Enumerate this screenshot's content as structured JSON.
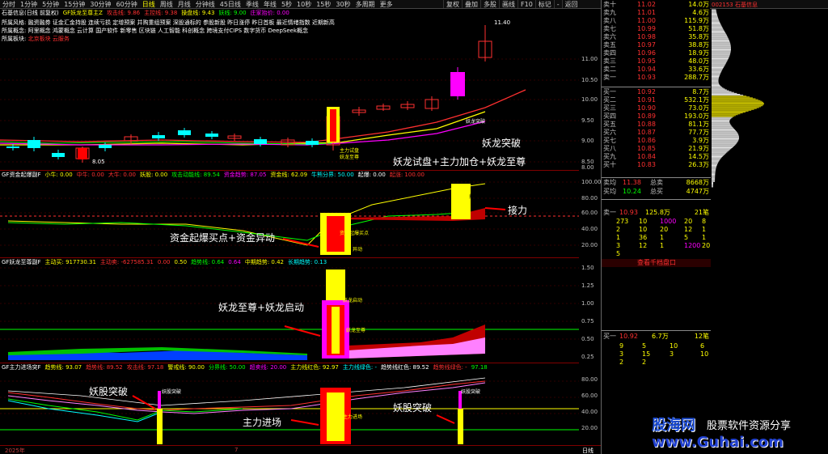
{
  "topbar": {
    "items": [
      "分时",
      "1分钟",
      "5分钟",
      "15分钟",
      "30分钟",
      "60分钟",
      "日线",
      "周线",
      "月线",
      "分钟线",
      "45日线",
      "季线",
      "年线",
      "5秒",
      "10秒",
      "15秒",
      "30秒",
      "多周期",
      "更多"
    ],
    "active_index": 6,
    "right_items": [
      "复权",
      "叠加",
      "多股",
      "画线",
      "F10",
      "标记",
      "-",
      "返回"
    ]
  },
  "stock_code": "002153",
  "stock_name": "石基信息",
  "main": {
    "title_parts": [
      "石基信息(日线 前复权)",
      "GF妖龙至尊主Z",
      "攻击线: 9.86",
      "主控线: 9.38",
      "操盘线: 9.43",
      "妖线: 9.00",
      "庄家抬价: 0.00"
    ],
    "info_lines": [
      [
        "所属风格:",
        "融资融券 证金汇金持股 连续亏损 定增预案 并购重组预案 深股通标的 参股新股 昨日涨停 昨日首板 最近情绪指数 近期新高"
      ],
      [
        "所属概念:",
        "阿里概念 鸿蒙概念 云计算 国产软件 新零售 区块链 人工智能 科创概念 跨境支付CIPS 数字货币 DeepSeek概念"
      ],
      [
        "所属板块:",
        "北京板块",
        "云服务"
      ]
    ],
    "price_high": "11.40",
    "price_low": "8.05",
    "annotations": [
      "妖龙突破",
      "妖龙试盘+主力加仓+妖龙至尊"
    ],
    "small_labels": [
      "妖龙突破",
      "主力试盘",
      "妖龙至尊"
    ],
    "axis_labels": [
      "11.00",
      "10.50",
      "10.00",
      "9.50",
      "9.00",
      "8.50",
      "8.00"
    ]
  },
  "panel2": {
    "title_parts": [
      "GF资金起爆副F",
      "小牛: 0.00",
      "中牛: 0.00",
      "大牛: 0.00",
      "妖股: 0.00",
      "攻击动能线: 89.54",
      "资金趋势: 87.05",
      "资金线: 62.09",
      "牛熊分界: 50.00",
      "起爆: 0.00",
      "起涨: 100.00"
    ],
    "annotations": [
      "资金起爆买点+资金异动",
      "接力"
    ],
    "small_labels": [
      "接力",
      "资金起爆买点",
      "异动"
    ],
    "axis_labels": [
      "100.00",
      "80.00",
      "60.00",
      "40.00",
      "20.00"
    ]
  },
  "panel3": {
    "title_parts": [
      "GF妖龙至尊副F",
      "主动买: 917730.31",
      "主动卖: -627585.31",
      "0.00",
      "0.50",
      "趋势线: 0.64",
      "0.64",
      "中期趋势: 0.42",
      "长期趋势: 0.13"
    ],
    "annotations": [
      "妖龙至尊+妖龙启动"
    ],
    "small_labels": [
      "妖龙启动",
      "妖龙至尊"
    ],
    "axis_labels": [
      "1.50",
      "1.25",
      "1.00",
      "0.75",
      "0.50",
      "0.25"
    ]
  },
  "panel4": {
    "title_parts": [
      "GF主力进场突F",
      "趋势线: 93.07",
      "趋势线: 89.52",
      "攻击线: 97.18",
      "警戒线: 90.00",
      "分界线: 50.00",
      "超卖线: 20.00",
      "主力线红色: 92.97",
      "主力线绿色: -",
      "趋势线红色: 89.52",
      "趋势线绿色: -",
      "97.18"
    ],
    "annotations": [
      "妖股突破",
      "主力进场",
      "妖股突破"
    ],
    "small_labels": [
      "妖股突破",
      "主力进场",
      "妖股突破"
    ],
    "axis_labels": [
      "80.00",
      "60.00",
      "40.00",
      "20.00"
    ]
  },
  "bottom": {
    "year": "2025年",
    "month": "7",
    "period": "日线"
  },
  "orderbook": {
    "asks": [
      {
        "label": "卖十",
        "price": "11.02",
        "vol": "14.0万"
      },
      {
        "label": "卖九",
        "price": "11.01",
        "vol": "4.6万"
      },
      {
        "label": "卖八",
        "price": "11.00",
        "vol": "115.9万"
      },
      {
        "label": "卖七",
        "price": "10.99",
        "vol": "51.8万"
      },
      {
        "label": "卖六",
        "price": "10.98",
        "vol": "35.8万"
      },
      {
        "label": "卖五",
        "price": "10.97",
        "vol": "38.8万"
      },
      {
        "label": "卖四",
        "price": "10.96",
        "vol": "18.9万"
      },
      {
        "label": "卖三",
        "price": "10.95",
        "vol": "48.0万"
      },
      {
        "label": "卖二",
        "price": "10.94",
        "vol": "33.6万"
      },
      {
        "label": "卖一",
        "price": "10.93",
        "vol": "288.7万"
      }
    ],
    "bids": [
      {
        "label": "买一",
        "price": "10.92",
        "vol": "8.7万"
      },
      {
        "label": "买二",
        "price": "10.91",
        "vol": "532.1万"
      },
      {
        "label": "买三",
        "price": "10.90",
        "vol": "73.0万"
      },
      {
        "label": "买四",
        "price": "10.89",
        "vol": "193.0万"
      },
      {
        "label": "买五",
        "price": "10.88",
        "vol": "81.1万"
      },
      {
        "label": "买六",
        "price": "10.87",
        "vol": "77.7万"
      },
      {
        "label": "买七",
        "price": "10.86",
        "vol": "3.9万"
      },
      {
        "label": "买八",
        "price": "10.85",
        "vol": "21.9万"
      },
      {
        "label": "买九",
        "price": "10.84",
        "vol": "14.5万"
      },
      {
        "label": "买十",
        "price": "10.83",
        "vol": "26.3万"
      }
    ],
    "summary": [
      {
        "label": "卖均",
        "price": "11.38",
        "name": "总卖",
        "val": "8668万"
      },
      {
        "label": "买均",
        "price": "10.24",
        "name": "总买",
        "val": "4747万"
      }
    ],
    "sell1": {
      "label": "卖一",
      "price": "10.93",
      "vol": "125.8万",
      "count": "21笔"
    },
    "sell1_rows": [
      [
        "273",
        "10",
        "1000",
        "20",
        "8"
      ],
      [
        "2",
        "10",
        "20",
        "12",
        "1"
      ],
      [
        "1",
        "36",
        "1",
        "5",
        "1"
      ],
      [
        "3",
        "12",
        "1",
        "1200",
        "20"
      ],
      [
        "5",
        "",
        "",
        "",
        ""
      ]
    ],
    "queue_label": "查看千档盘口",
    "buy1": {
      "label": "买一",
      "price": "10.92",
      "vol": "6.7万",
      "count": "12笔"
    },
    "buy1_rows": [
      [
        "9",
        "5",
        "10",
        "6"
      ],
      [
        "3",
        "15",
        "3",
        "10"
      ],
      [
        "2",
        "2",
        "",
        ""
      ]
    ]
  },
  "watermark": {
    "title": "股海网",
    "subtitle": "股票软件资源分享",
    "url": "www.Guhai.com"
  },
  "colors": {
    "up": "#ff3232",
    "down": "#00ffff",
    "yellow": "#ffff00",
    "magenta": "#ff00ff",
    "bg": "#000000"
  }
}
